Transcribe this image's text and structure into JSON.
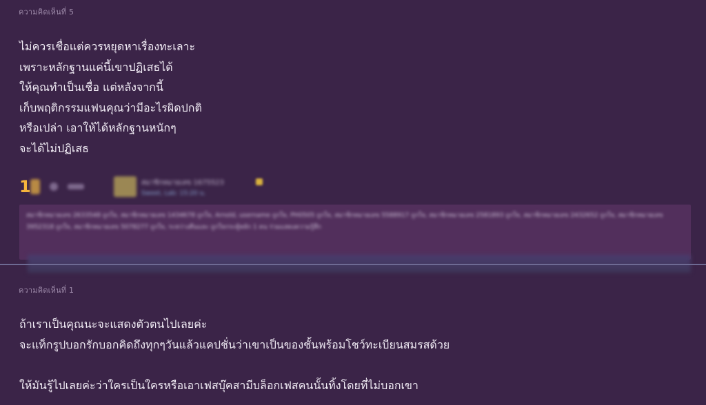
{
  "comments": [
    {
      "label": "ความคิดเห็นที่ 5",
      "body": "ไม่ควรเชื่อแต่ควรหยุดหาเรื่องทะเลาะ\nเพราะหลักฐานแค่นี้เขาปฏิเสธได้\nให้คุณทำเป็นเชื่อ แต่หลังจากนี้\nเก็บพฤติกรรมแฟนคุณว่ามีอะไรผิดปกติ\nหรือเปล่า เอาให้ได้หลักฐานหนักๆ\nจะได้ไม่ปฏิเสธ",
      "vote_count": "1",
      "author_name": "สมาชิกหมายเลข 1675523",
      "author_time": "Sweet, Lab: 15:20 น.",
      "reactions_text": "สมาชิกหมายเลข 2633548 ถูกใจ, สมาชิกหมายเลข 1434678 ถูกใจ, Arnold, username ถูกใจ, PH0505 ถูกใจ, สมาชิกหมายเลข 5588917 ถูกใจ, สมาชิกหมายเลข 2581893 ถูกใจ, สมาชิกหมายเลข 2432652 ถูกใจ, สมาชิกหมายเลข 3952318 ถูกใจ, สมาชิกหมายเลข 5078277 ถูกใจ, ระหว่างคืนและ ถูกใจกระทู้หลัก 1 คน ร่วมแสดงความรู้สึก"
    },
    {
      "label": "ความคิดเห็นที่ 1",
      "body": "ถ้าเราเป็นคุณนะจะแสดงตัวตนไปเลยค่ะ\nจะแท็กรูปบอกรักบอกคิดถึงทุกๆวันแล้วแคปชั่นว่าเขาเป็นของชั้นพร้อมโชว์ทะเบียนสมรสด้วย\n\nให้มันรู้ไปเลยค่ะว่าใครเป็นใครหรือเอาเฟสบุ๊คสามีบล็อกเฟสคนนั้นทิ้งโดยที่ไม่บอกเขา"
    }
  ],
  "colors": {
    "background": "#3b2448",
    "vote_accent": "#f6b43c",
    "divider": "#6e6a93"
  }
}
